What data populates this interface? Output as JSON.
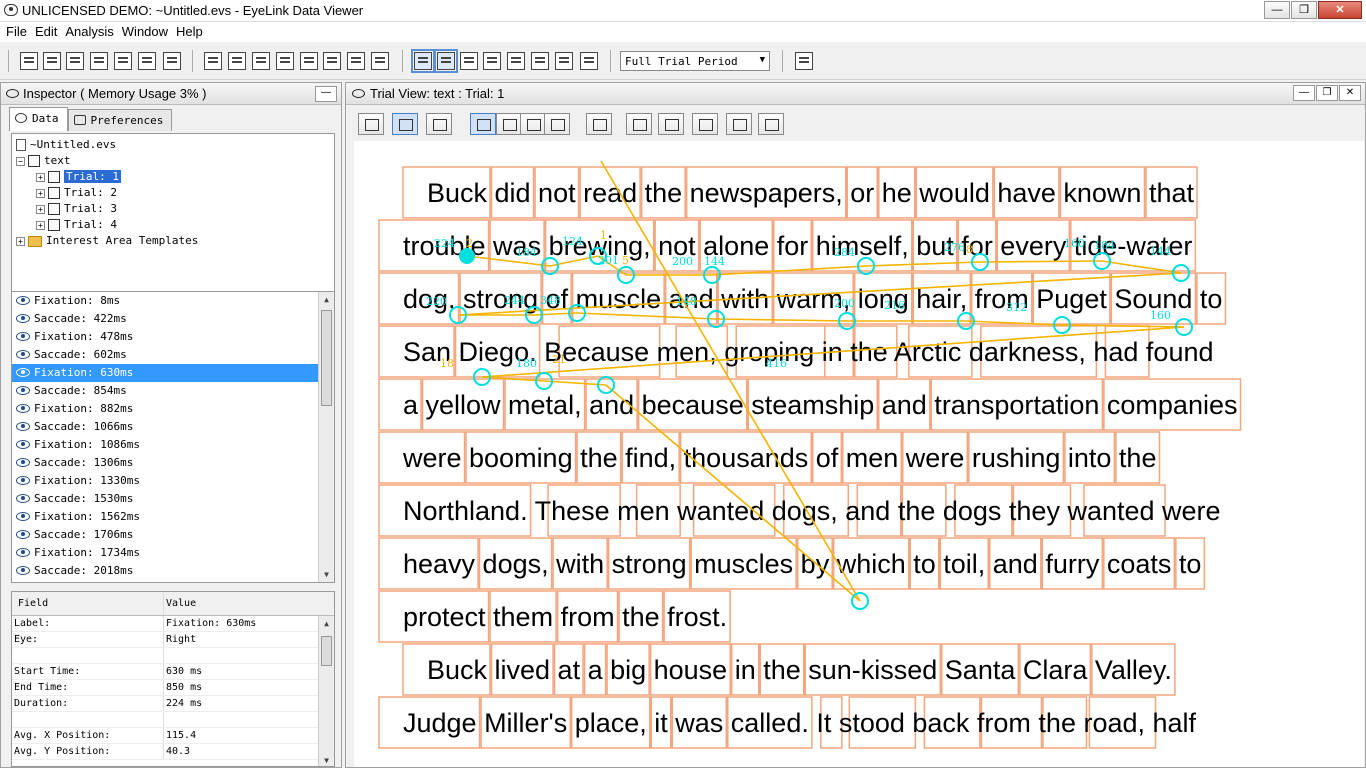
{
  "window": {
    "title": "UNLICENSED DEMO: ~Untitled.evs - EyeLink Data Viewer",
    "buttons": {
      "minimize": "—",
      "restore": "❐",
      "close": "✕"
    }
  },
  "menu": [
    "File",
    "Edit",
    "Analysis",
    "Window",
    "Help"
  ],
  "toolbar": {
    "period": "Full Trial Period"
  },
  "inspector": {
    "title": "Inspector ( Memory Usage 3% )",
    "min_label": "—",
    "tabs": [
      "Data",
      "Preferences"
    ],
    "tree": {
      "root": "~Untitled.evs",
      "session": "text",
      "trials": [
        "Trial: 1",
        "Trial: 2",
        "Trial: 3",
        "Trial: 4"
      ],
      "templates": "Interest Area Templates"
    },
    "events": [
      "Fixation: 8ms",
      "Saccade: 422ms",
      "Fixation: 478ms",
      "Saccade: 602ms",
      "Fixation: 630ms",
      "Saccade: 854ms",
      "Fixation: 882ms",
      "Saccade: 1066ms",
      "Fixation: 1086ms",
      "Saccade: 1306ms",
      "Fixation: 1330ms",
      "Saccade: 1530ms",
      "Fixation: 1562ms",
      "Saccade: 1706ms",
      "Fixation: 1734ms",
      "Saccade: 2018ms"
    ],
    "selected_event": 4,
    "props_header": {
      "field": "Field",
      "value": "Value"
    },
    "props": [
      {
        "k": "Label:",
        "v": "Fixation: 630ms"
      },
      {
        "k": "Eye:",
        "v": "Right"
      },
      {
        "k": "",
        "v": ""
      },
      {
        "k": "Start Time:",
        "v": "630 ms"
      },
      {
        "k": "End Time:",
        "v": "850 ms"
      },
      {
        "k": "Duration:",
        "v": "224 ms"
      },
      {
        "k": "",
        "v": ""
      },
      {
        "k": "Avg. X Position:",
        "v": "115.4"
      },
      {
        "k": "Avg. Y Position:",
        "v": "40.3"
      }
    ]
  },
  "trialview": {
    "title": "Trial View: text : Trial: 1",
    "buttons": {
      "minimize": "—",
      "restore": "❐",
      "close": "✕"
    },
    "lines": [
      "Buck did not read the newspapers, or he would have known that",
      "trouble was brewing, not alone for himself, but for every tide-water",
      "dog, strong of muscle and with warm, long hair, from Puget Sound to",
      "San Diego.  Because men, groping in the Arctic darkness, had found",
      "a yellow metal, and because steamship and transportation companies",
      "were booming the find, thousands of men were rushing into the",
      "Northland.  These men wanted dogs, and the dogs they wanted were",
      "heavy dogs, with strong muscles by which to toil, and furry coats to",
      "protect them from the frost.",
      "Buck lived at a big house in the sun-kissed Santa Clara Valley.",
      "Judge Miller's place, it was called.  It stood back from the road, half"
    ],
    "fixation_labels": [
      "224",
      "2",
      "184",
      "124",
      "1",
      "201",
      "5",
      "200",
      "144",
      "284",
      "276",
      "8",
      "160",
      "184",
      "144",
      "220",
      "244",
      "348",
      "148",
      "200",
      "216",
      "312",
      "160",
      "18",
      "180",
      "21",
      "416"
    ],
    "colors": {
      "area": "#f4a57e",
      "fixation": "#00dede",
      "saccade": "#f5b400"
    }
  }
}
